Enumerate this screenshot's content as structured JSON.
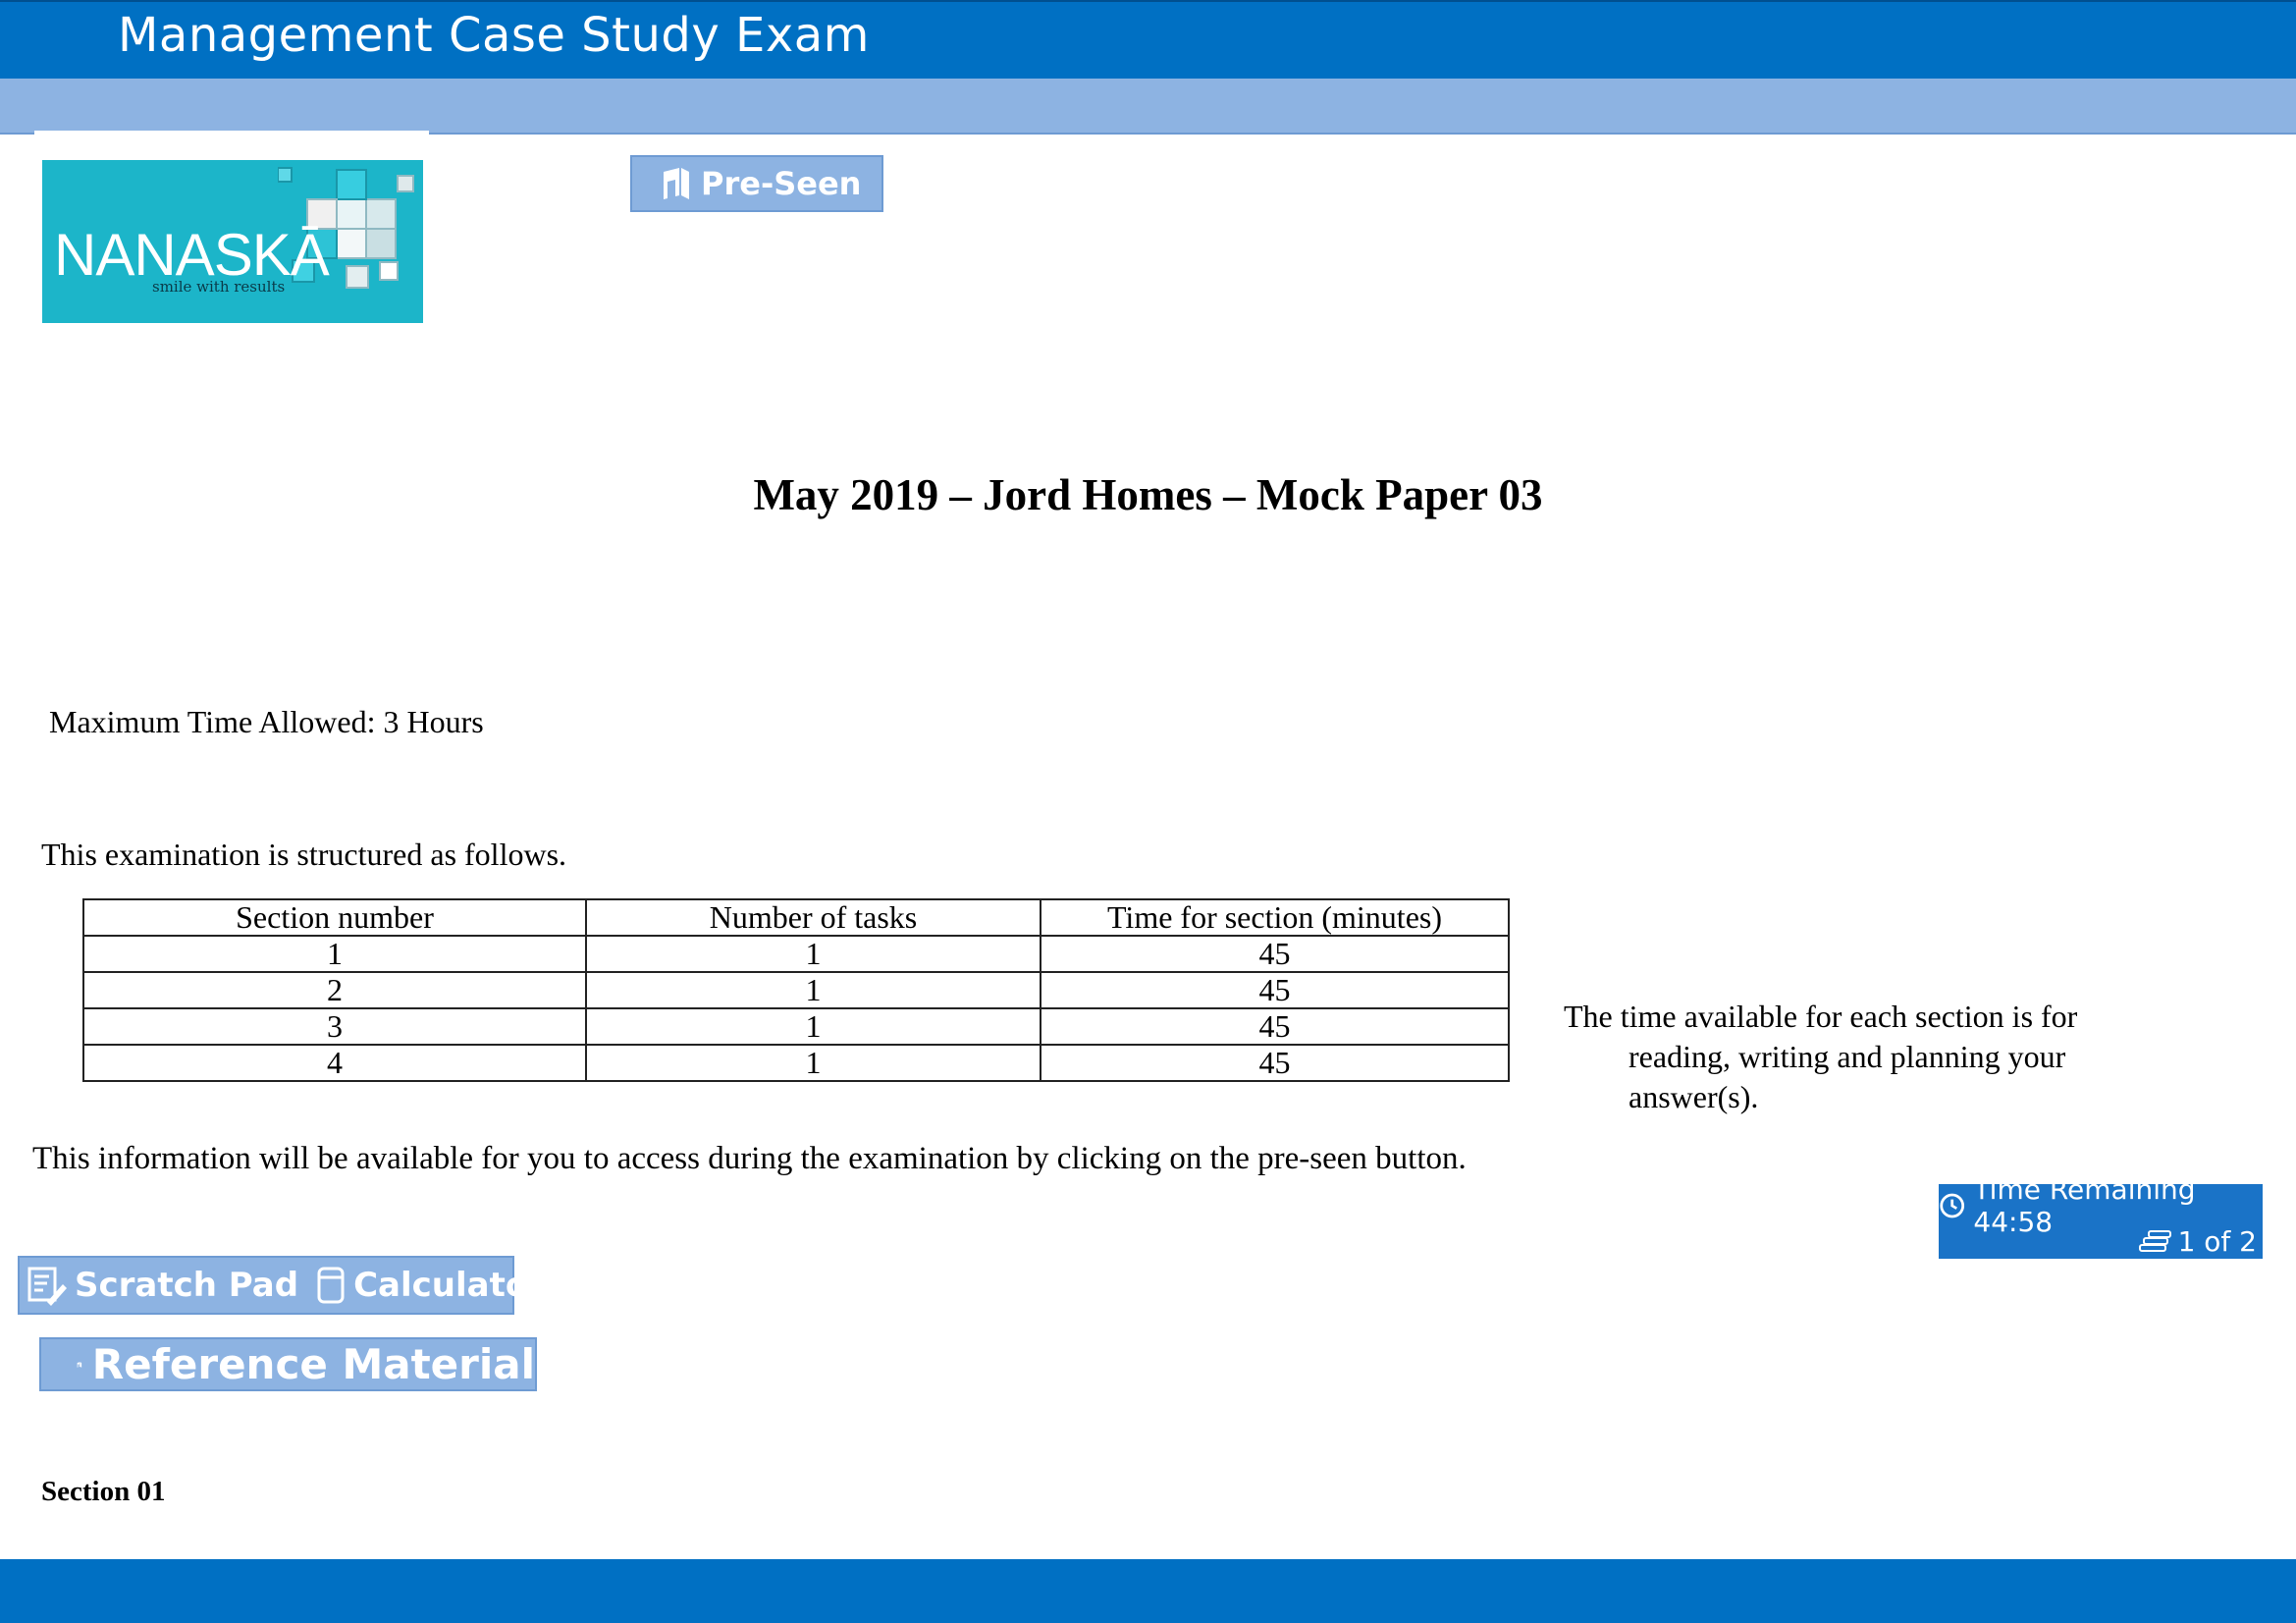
{
  "header": {
    "title": "Management Case Study Exam"
  },
  "logo": {
    "name": "NANASKĀ",
    "tagline": "smile with results"
  },
  "toolbar": {
    "preseen_label": "Pre-Seen",
    "scratch_pad_label": "Scratch Pad",
    "calculator_label": "Calculator",
    "reference_label": "Reference Material"
  },
  "main": {
    "heading": "May 2019 – Jord Homes – Mock Paper 03",
    "max_time": "Maximum Time Allowed: 3 Hours",
    "structure_intro": "This examination is structured as follows.",
    "table": {
      "headers": [
        "Section number",
        "Number of tasks",
        "Time for section (minutes)"
      ],
      "rows": [
        [
          "1",
          "1",
          "45"
        ],
        [
          "2",
          "1",
          "45"
        ],
        [
          "3",
          "1",
          "45"
        ],
        [
          "4",
          "1",
          "45"
        ]
      ]
    },
    "side_note_line1": "The time available for each section is for",
    "side_note_line2": "reading, writing and planning your",
    "side_note_line3": "answer(s).",
    "access_note": "This information will be available for you to access during the examination by clicking on the pre-seen button.",
    "section_label": "Section 01"
  },
  "timer": {
    "label": "Time Remaining 44:58",
    "page": "1 of 2"
  },
  "colors": {
    "header_blue": "#0070c3",
    "light_blue": "#8db3e2",
    "logo_teal": "#1cb5c9",
    "timer_blue": "#1a73c7"
  }
}
